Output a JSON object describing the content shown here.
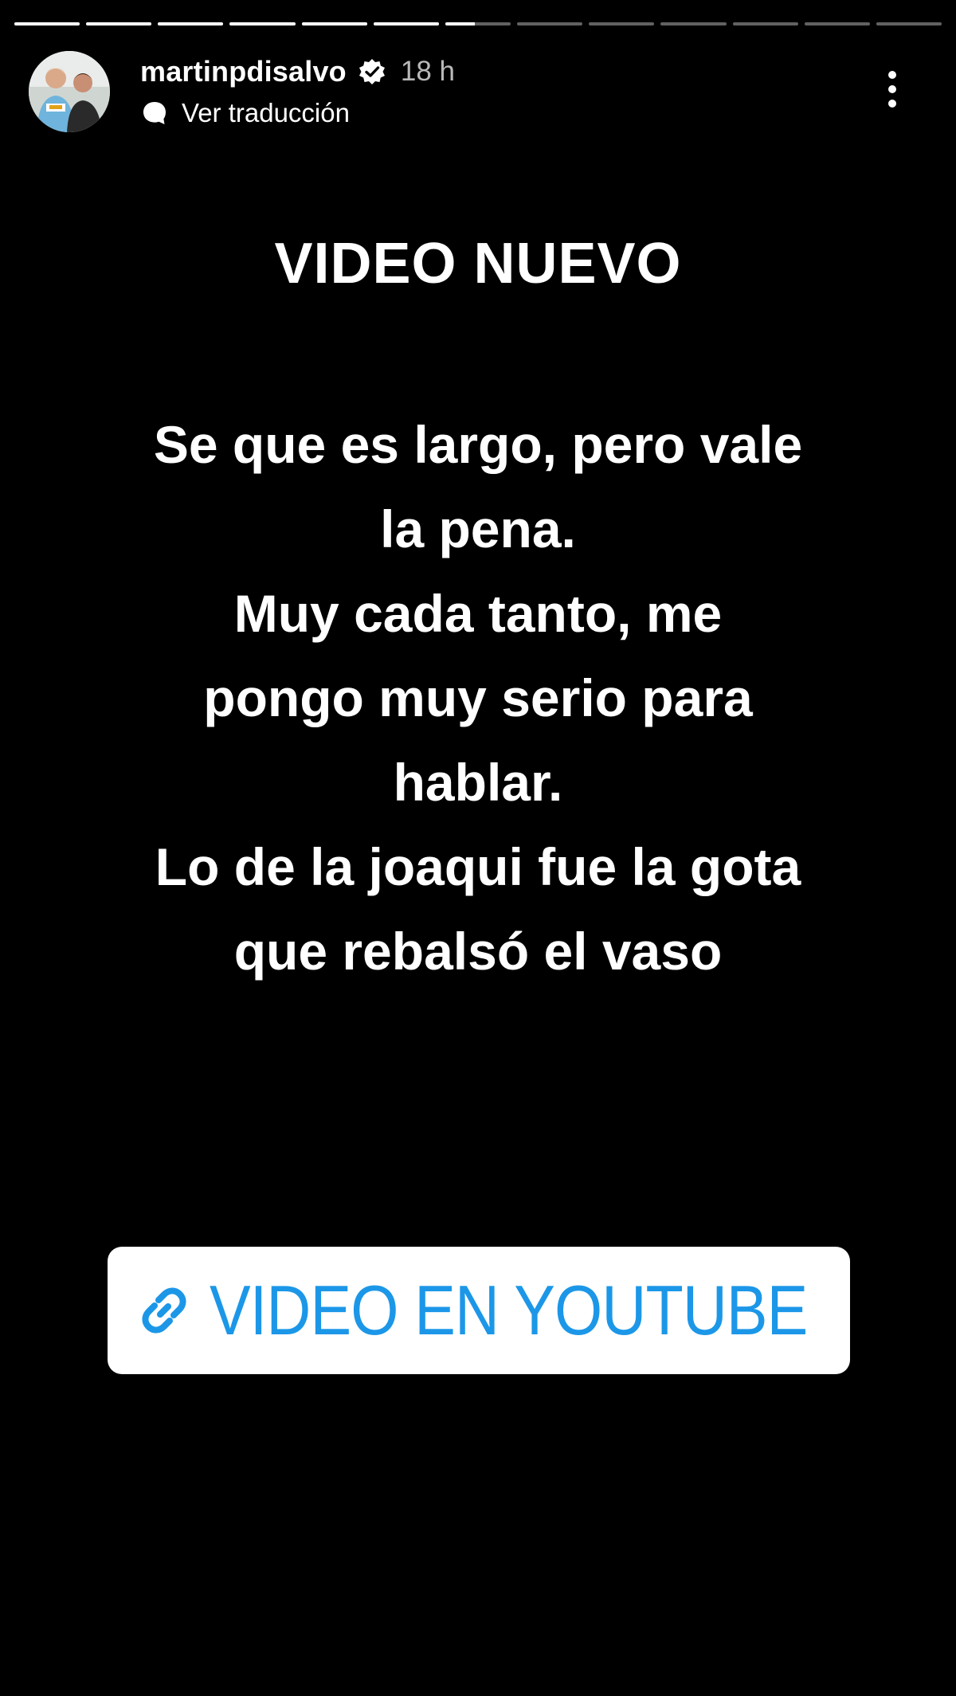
{
  "story": {
    "segments_total": 13,
    "segments_viewed": 7,
    "current_segment_progress": 0.45
  },
  "header": {
    "username": "martinpdisalvo",
    "verified_icon": "verified-badge-icon",
    "time_ago": "18 h",
    "translate_icon": "translate-bubble-icon",
    "translate_label": "Ver traducción",
    "more_icon": "more-vertical-icon"
  },
  "content": {
    "headline": "VIDEO NUEVO",
    "lines": [
      "Se que es largo, pero vale",
      "la pena.",
      "Muy cada tanto, me",
      "pongo muy serio para",
      "hablar.",
      "Lo de la joaqui fue la gota",
      "que rebalsó el vaso"
    ]
  },
  "link_sticker": {
    "icon": "link-icon",
    "label": "VIDEO EN YOUTUBE",
    "color": "#1c97e8"
  },
  "colors": {
    "background": "#000000",
    "text": "#ffffff",
    "link": "#1c97e8"
  }
}
